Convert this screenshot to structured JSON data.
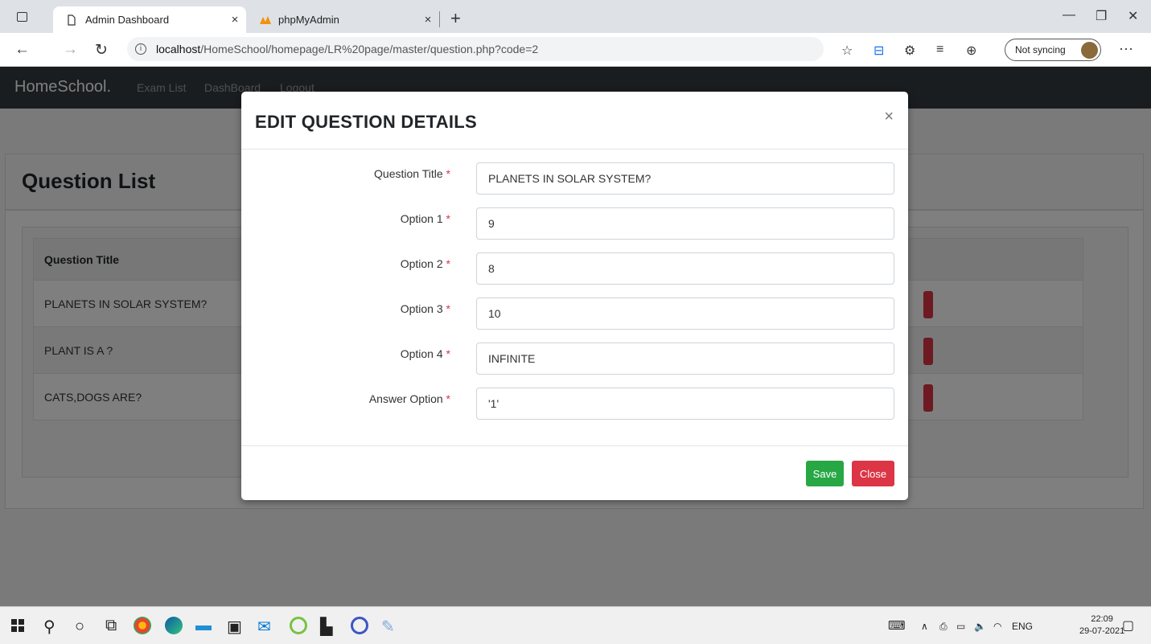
{
  "browser": {
    "tabs": [
      {
        "label": "Admin Dashboard",
        "active": true
      },
      {
        "label": "phpMyAdmin",
        "active": false
      }
    ],
    "tab_close": "×",
    "new_tab": "+",
    "window_controls": {
      "minimize": "—",
      "restore": "❐",
      "close": "✕"
    },
    "url_host": "localhost",
    "url_path": "/HomeSchool/homepage/LR%20page/master/question.php?code=2",
    "sync_label": "Not syncing",
    "more": "···"
  },
  "navbar": {
    "brand": "HomeSchool.",
    "links": [
      "Exam List",
      "DashBoard",
      "Logout"
    ]
  },
  "page": {
    "title": "Question List",
    "table_header": "Question Title",
    "rows": [
      "PLANETS IN SOLAR SYSTEM?",
      "PLANT IS A ?",
      "CATS,DOGS ARE?"
    ]
  },
  "modal": {
    "title": "EDIT QUESTION DETAILS",
    "close_glyph": "×",
    "required_mark": "*",
    "fields": [
      {
        "label": "Question Title",
        "value": "PLANETS IN SOLAR SYSTEM?"
      },
      {
        "label": "Option 1",
        "value": "9"
      },
      {
        "label": "Option 2",
        "value": "8"
      },
      {
        "label": "Option 3",
        "value": "10"
      },
      {
        "label": "Option 4",
        "value": "INFINITE"
      },
      {
        "label": "Answer Option",
        "value": "'1'"
      }
    ],
    "save_label": "Save",
    "close_label": "Close"
  },
  "taskbar": {
    "language": "ENG",
    "time": "22:09",
    "date": "29-07-2021"
  },
  "colors": {
    "navbar": "#343a40",
    "save": "#28a745",
    "danger": "#dc3545"
  }
}
